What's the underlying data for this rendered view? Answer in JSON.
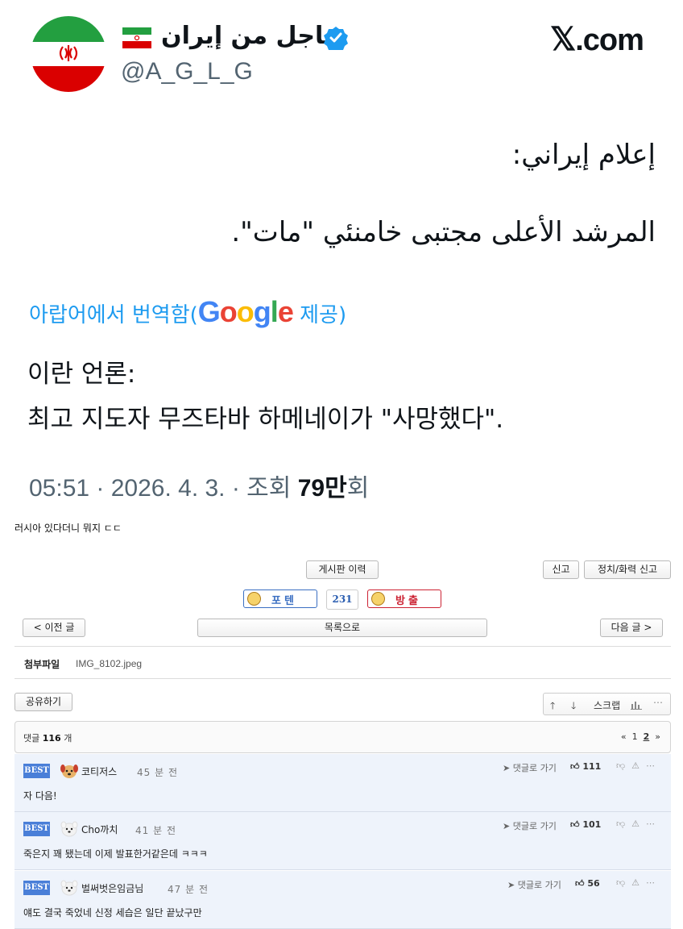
{
  "tweet": {
    "account_name": "عاجل من إيران",
    "handle": "@A_G_L_G",
    "site": ".com",
    "arabic_line1": "إعلام إيراني:",
    "arabic_line2": "المرشد الأعلى مجتبى خامنئي \"مات\".",
    "translated_prefix": "아랍어에서 번역함(",
    "translated_provider": "Google",
    "translated_suffix": " 제공)",
    "korean_line1": "이란 언론:",
    "korean_line2": "최고 지도자 무즈타바 하메네이가 \"사망했다\".",
    "meta_prefix": "05:51 · 2026. 4. 3. · 조회 ",
    "meta_views": "79만",
    "meta_suffix": "회",
    "colors": {
      "flag_green": "#239f40",
      "flag_red": "#da0000",
      "verified": "#1d9bf0",
      "link": "#1d9bf0"
    }
  },
  "post": {
    "body_text": "러시아 있다더니 뭐지 ㄷㄷ",
    "history_button": "게시판 이력",
    "report_button": "신고",
    "report_politics_button": "정치/화력 신고",
    "vote_up_label": "포텐",
    "vote_count": "231",
    "vote_down_label": "방출",
    "prev_button": "< 이전 글",
    "list_button": "목록으로",
    "next_button": "다음 글 >",
    "attach_label": "첨부파일",
    "attach_file": "IMG_8102.jpeg",
    "share_button": "공유하기",
    "scrap_label": "스크랩"
  },
  "comments_bar": {
    "label": "댓글",
    "count": "116",
    "unit": "개",
    "pages": [
      "1",
      "2"
    ],
    "current_page": "2"
  },
  "comments": [
    {
      "badge": "BEST",
      "nick": "코티저스",
      "time": "45 분 전",
      "text": "자 다음!",
      "reply": "댓글로 가기",
      "likes": "111"
    },
    {
      "badge": "BEST",
      "nick": "Cho까치",
      "time": "41 분 전",
      "text": "죽은지 꽤 됐는데 이제 발표한거같은데 ㅋㅋㅋ",
      "reply": "댓글로 가기",
      "likes": "101"
    },
    {
      "badge": "BEST",
      "nick": "벌써벗은임금님",
      "time": "47 분 전",
      "text": "얘도 결국 죽었네 신정 세습은 일단 끝났구만",
      "reply": "댓글로 가기",
      "likes": "56"
    }
  ]
}
